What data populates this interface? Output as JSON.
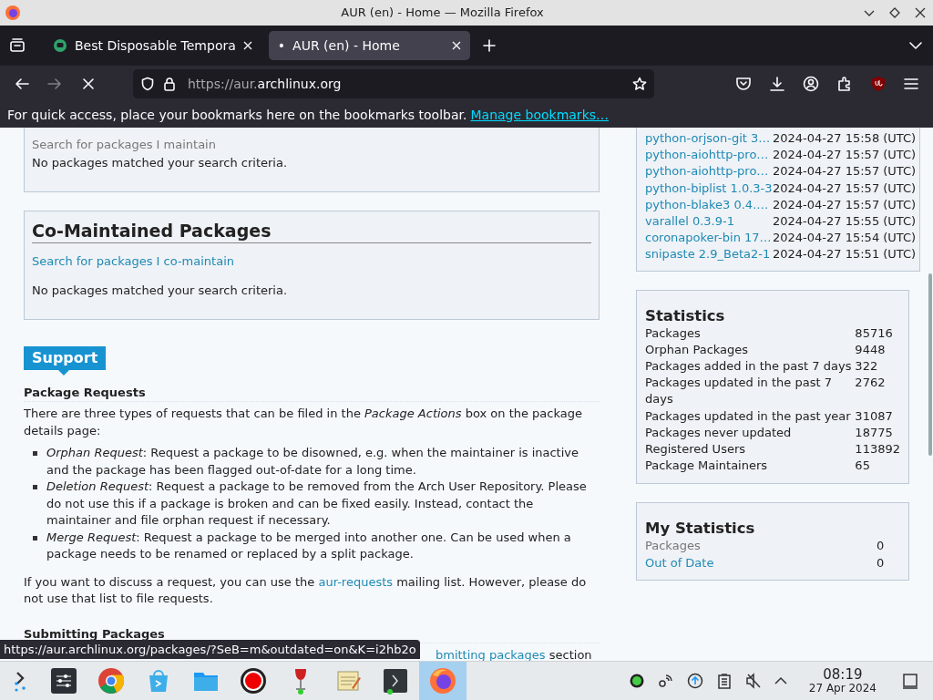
{
  "window": {
    "title": "AUR (en) - Home — Mozilla Firefox"
  },
  "tabs": [
    {
      "label": "Best Disposable Tempora",
      "selected": false
    },
    {
      "label": "AUR (en) - Home",
      "selected": true,
      "marker": "•"
    }
  ],
  "toolbar": {
    "forward": {
      "disabled": true
    },
    "url_prefix": "https://aur.",
    "url_domain": "archlinux.org"
  },
  "bookmarks_bar": {
    "text": "For quick access, place your bookmarks here on the bookmarks toolbar.",
    "link": "Manage bookmarks…"
  },
  "maintained": {
    "search_link": "Search for packages I maintain",
    "empty": "No packages matched your search criteria."
  },
  "co_maintained": {
    "title": "Co-Maintained Packages",
    "search_link": "Search for packages I co-maintain",
    "empty": "No packages matched your search criteria."
  },
  "support": {
    "title": "Support",
    "heading": "Package Requests",
    "intro": "There are three types of requests that can be filed in the *Package Actions* box on the package details page:",
    "items": [
      {
        "text": "*Orphan Request*: Request a package to be disowned, e.g. when the maintainer is inactive and the package has been flagged out-of-date for a long time."
      },
      {
        "text": "*Deletion Request*: Request a package to be removed from the Arch User Repository. Please do not use this if a package is broken and can be fixed easily. Instead, contact the maintainer and file orphan request if necessary."
      },
      {
        "text": "*Merge Request*: Request a package to be merged into another one. Can be used when a package needs to be renamed or replaced by a split package."
      }
    ],
    "discuss_before": "If you want to discuss a request, you can use the",
    "discuss_link": "aur-requests",
    "discuss_after": "mailing list. However, please do not use that list to file requests.",
    "next_heading": "Submitting Packages",
    "next_link_fragment": "bmitting packages",
    "next_after": "section"
  },
  "recent_updates": [
    {
      "name": "python-orjson-git 3…",
      "date": "2024-04-27 15:58 (UTC)"
    },
    {
      "name": "python-aiohttp-pro…",
      "date": "2024-04-27 15:57 (UTC)"
    },
    {
      "name": "python-aiohttp-pro…",
      "date": "2024-04-27 15:57 (UTC)"
    },
    {
      "name": "python-biplist 1.0.3-3",
      "date": "2024-04-27 15:57 (UTC)"
    },
    {
      "name": "python-blake3 0.4.…",
      "date": "2024-04-27 15:57 (UTC)"
    },
    {
      "name": "varallel 0.3.9-1",
      "date": "2024-04-27 15:55 (UTC)"
    },
    {
      "name": "coronapoker-bin 17…",
      "date": "2024-04-27 15:54 (UTC)"
    },
    {
      "name": "snipaste 2.9_Beta2-1",
      "date": "2024-04-27 15:51 (UTC)"
    }
  ],
  "statistics": {
    "title": "Statistics",
    "rows": [
      {
        "label": "Packages",
        "value": "85716"
      },
      {
        "label": "Orphan Packages",
        "value": "9448"
      },
      {
        "label": "Packages added in the past 7 days",
        "value": "322"
      },
      {
        "label": "Packages updated in the past 7 days",
        "value": "2762"
      },
      {
        "label": "Packages updated in the past year",
        "value": "31087"
      },
      {
        "label": "Packages never updated",
        "value": "18775"
      },
      {
        "label": "Registered Users",
        "value": "113892"
      },
      {
        "label": "Package Maintainers",
        "value": "65"
      }
    ]
  },
  "my_statistics": {
    "title": "My Statistics",
    "rows": [
      {
        "label": "Packages",
        "value": "0",
        "kind": "muted"
      },
      {
        "label": "Out of Date",
        "value": "0",
        "kind": "link"
      }
    ]
  },
  "status_tooltip": "https://aur.archlinux.org/packages/?SeB=m&outdated=on&K=i2hb2o",
  "taskbar": {
    "apps": [
      {
        "kind": "launcher",
        "active": false
      },
      {
        "kind": "mixer",
        "active": false
      },
      {
        "kind": "chrome",
        "active": false
      },
      {
        "kind": "store",
        "active": false
      },
      {
        "kind": "files",
        "active": false
      },
      {
        "kind": "recorder",
        "active": false
      },
      {
        "kind": "wine",
        "active": false
      },
      {
        "kind": "editor",
        "active": false
      },
      {
        "kind": "terminal",
        "active": false
      },
      {
        "kind": "firefox",
        "active": true
      }
    ],
    "time": "08:19",
    "date": "27 Apr 2024"
  }
}
